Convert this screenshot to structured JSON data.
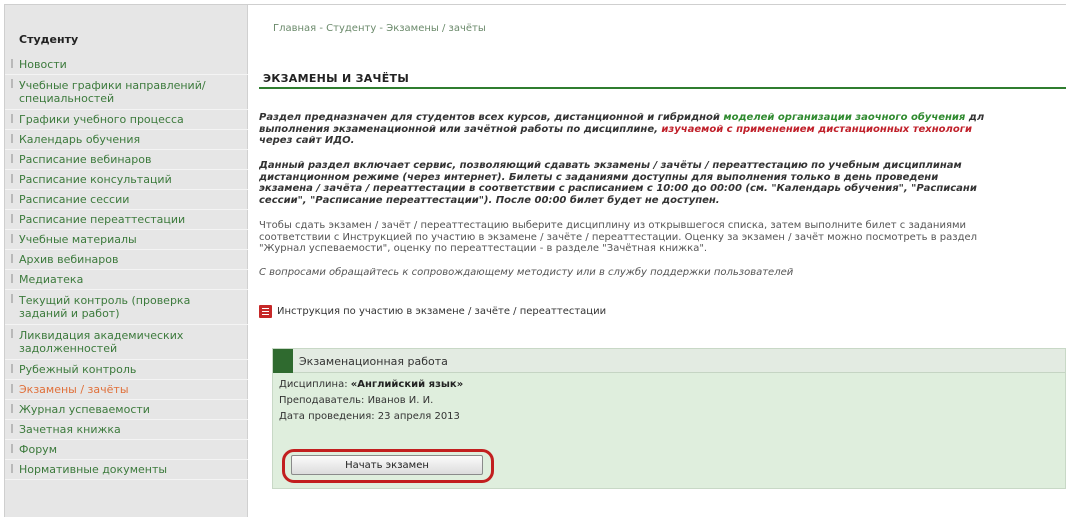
{
  "sidebar": {
    "title": "Студенту",
    "items": [
      {
        "label": "Новости"
      },
      {
        "label": "Учебные графики направлений/ специальностей"
      },
      {
        "label": "Графики учебного процесса"
      },
      {
        "label": "Календарь обучения"
      },
      {
        "label": "Расписание вебинаров"
      },
      {
        "label": "Расписание консультаций"
      },
      {
        "label": "Расписание сессии"
      },
      {
        "label": "Расписание переаттестации"
      },
      {
        "label": "Учебные материалы"
      },
      {
        "label": "Архив вебинаров"
      },
      {
        "label": "Медиатека"
      },
      {
        "label": "Текущий контроль (проверка заданий и работ)"
      },
      {
        "label": "Ликвидация академических задолженностей"
      },
      {
        "label": "Рубежный контроль"
      },
      {
        "label": "Экзамены / зачёты"
      },
      {
        "label": "Журнал успеваемости"
      },
      {
        "label": "Зачетная книжка"
      },
      {
        "label": "Форум"
      },
      {
        "label": "Нормативные документы"
      }
    ],
    "active_index": 14
  },
  "breadcrumb": {
    "home": "Главная",
    "section": "Студенту",
    "current": "Экзамены / зачёты",
    "separator": " - "
  },
  "page": {
    "title": "ЭКЗАМЕНЫ И ЗАЧЁТЫ",
    "p1_a": "Раздел предназначен для студентов всех курсов, дистанционной и гибридной ",
    "p1_b": "моделей организации заочного обучения",
    "p1_c": " дл",
    "p1_line2_a": "выполнения экзаменационной или зачётной работы по дисциплине, ",
    "p1_line2_b": "изучаемой с применением дистанционных технологи",
    "p1_line3": "через сайт ИДО.",
    "p2_line1": "Данный раздел включает сервис, позволяющий сдавать экзамены / зачёты / переаттестацию по учебным дисциплинам",
    "p2_line2": "дистанционном режиме (через интернет). Билеты с заданиями доступны для выполнения только в день проведени",
    "p2_line3": "экзамена / зачёта / переаттестации в соответствии с расписанием с 10:00 до 00:00 (см. \"Календарь обучения\", \"Расписани",
    "p2_line4": "сессии\", \"Расписание переаттестации\"). После 00:00 билет будет не доступен.",
    "p3_line1": "Чтобы сдать экзамен / зачёт / переаттестацию выберите дисциплину из открывшегося списка, затем выполните билет с заданиями",
    "p3_line2": "соответствии с Инструкцией по участию в экзамене / зачёте / переаттестации. Оценку за экзамен / зачёт можно посмотреть в раздел",
    "p3_line3": "\"Журнал успеваемости\", оценку по переаттестации - в разделе \"Зачётная книжка\".",
    "p4": "С вопросами обращайтесь к сопровождающему методисту или в службу поддержки пользователей",
    "instruction_link": "Инструкция по участию в экзамене / зачёте / переаттестации",
    "instruction_icon": "pdf-icon"
  },
  "exam": {
    "header": "Экзаменационная работа",
    "discipline_label": "Дисциплина: ",
    "discipline_value": "«Английский язык»",
    "teacher_label": "Преподаватель: ",
    "teacher_value": "Иванов И. И.",
    "date_label": "Дата проведения: ",
    "date_value": "23 апреля 2013",
    "start_button": "Начать экзамен"
  },
  "colors": {
    "link_green": "#3c7a3c",
    "active_orange": "#e0703a",
    "title_rule": "#2f7d2f",
    "highlight_red": "#c21f1f"
  }
}
